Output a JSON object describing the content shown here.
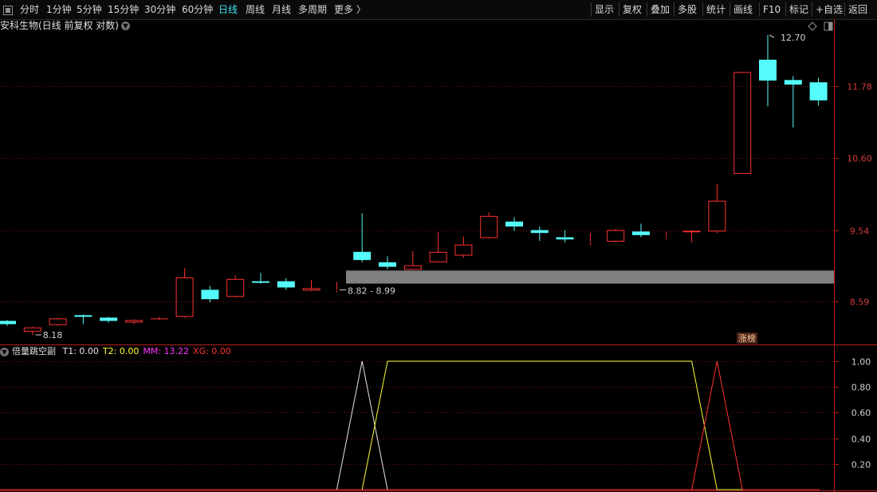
{
  "toolbar": {
    "left_items": [
      {
        "label": "分时"
      },
      {
        "label": "1分钟"
      },
      {
        "label": "5分钟"
      },
      {
        "label": "15分钟"
      },
      {
        "label": "30分钟"
      },
      {
        "label": "60分钟"
      },
      {
        "label": "日线",
        "active": true
      },
      {
        "label": "周线"
      },
      {
        "label": "月线"
      },
      {
        "label": "多周期"
      },
      {
        "label": "更多 〉"
      }
    ],
    "right_items": [
      {
        "label": "显示"
      },
      {
        "label": "复权"
      },
      {
        "label": "叠加"
      },
      {
        "label": "多股"
      },
      {
        "label": "统计"
      },
      {
        "label": "画线"
      },
      {
        "label": "F10"
      },
      {
        "label": "标记"
      },
      {
        "label": "+自选"
      },
      {
        "label": "返回"
      }
    ]
  },
  "main_chart": {
    "title": "安科生物(日线 前复权 对数)",
    "annotations": {
      "high_label": "12.70",
      "low_label": "8.18",
      "range_label": "8.82 - 8.99",
      "badge": "涨榜"
    }
  },
  "indicator": {
    "name": "倍量跳空副",
    "values": [
      {
        "key": "T1",
        "value": "0.00",
        "color": "#e6e6e6"
      },
      {
        "key": "T2",
        "value": "0.00",
        "color": "#ffff33"
      },
      {
        "key": "MM",
        "value": "13.22",
        "color": "#ff33ff"
      },
      {
        "key": "XG",
        "value": "0.00",
        "color": "#ff3333"
      }
    ]
  },
  "colors": {
    "up": "#ff3232",
    "down": "#54fcfc",
    "zone": "#808080",
    "axis": "#b41e1e",
    "grid": "#7a1010"
  },
  "chart_data": [
    {
      "type": "candlestick",
      "title": "",
      "y_scale": "log",
      "ylim": [
        8.18,
        12.7
      ],
      "y_ticks": [
        8.59,
        9.54,
        10.6,
        11.78
      ],
      "y_tick_labels": [
        "8.59",
        "9.54",
        "10.60",
        "11.78"
      ],
      "zone": {
        "low": 8.82,
        "high": 8.99
      },
      "candles": [
        {
          "o": 8.35,
          "c": 8.31,
          "h": 8.36,
          "l": 8.29
        },
        {
          "o": 8.22,
          "c": 8.27,
          "h": 8.28,
          "l": 8.18
        },
        {
          "o": 8.3,
          "c": 8.38,
          "h": 8.39,
          "l": 8.29
        },
        {
          "o": 8.42,
          "c": 8.4,
          "h": 8.43,
          "l": 8.31
        },
        {
          "o": 8.39,
          "c": 8.35,
          "h": 8.4,
          "l": 8.33
        },
        {
          "o": 8.33,
          "c": 8.36,
          "h": 8.37,
          "l": 8.31
        },
        {
          "o": 8.37,
          "c": 8.38,
          "h": 8.4,
          "l": 8.36
        },
        {
          "o": 8.4,
          "c": 8.9,
          "h": 9.02,
          "l": 8.39
        },
        {
          "o": 8.74,
          "c": 8.62,
          "h": 8.79,
          "l": 8.58
        },
        {
          "o": 8.65,
          "c": 8.88,
          "h": 8.93,
          "l": 8.64
        },
        {
          "o": 8.85,
          "c": 8.83,
          "h": 8.96,
          "l": 8.82
        },
        {
          "o": 8.85,
          "c": 8.77,
          "h": 8.89,
          "l": 8.74
        },
        {
          "o": 8.73,
          "c": 8.76,
          "h": 8.87,
          "l": 8.72
        },
        {
          "o": 8.73,
          "c": 8.74,
          "h": 8.84,
          "l": 8.71
        },
        {
          "o": 9.24,
          "c": 9.13,
          "h": 9.78,
          "l": 9.1
        },
        {
          "o": 9.1,
          "c": 9.04,
          "h": 9.18,
          "l": 9.01
        },
        {
          "o": 9.0,
          "c": 9.06,
          "h": 9.25,
          "l": 9.0
        },
        {
          "o": 9.1,
          "c": 9.24,
          "h": 9.51,
          "l": 9.1
        },
        {
          "o": 9.19,
          "c": 9.34,
          "h": 9.45,
          "l": 9.16
        },
        {
          "o": 9.43,
          "c": 9.74,
          "h": 9.79,
          "l": 9.42
        },
        {
          "o": 9.66,
          "c": 9.59,
          "h": 9.72,
          "l": 9.53
        },
        {
          "o": 9.54,
          "c": 9.5,
          "h": 9.59,
          "l": 9.39
        },
        {
          "o": 9.44,
          "c": 9.41,
          "h": 9.54,
          "l": 9.37
        },
        {
          "o": 9.37,
          "c": 9.38,
          "h": 9.5,
          "l": 9.33
        },
        {
          "o": 9.38,
          "c": 9.54,
          "h": 9.56,
          "l": 9.37
        },
        {
          "o": 9.52,
          "c": 9.47,
          "h": 9.63,
          "l": 9.44
        },
        {
          "o": 9.44,
          "c": 9.45,
          "h": 9.52,
          "l": 9.41
        },
        {
          "o": 9.51,
          "c": 9.53,
          "h": 9.54,
          "l": 9.37
        },
        {
          "o": 9.52,
          "c": 9.96,
          "h": 10.21,
          "l": 9.5
        },
        {
          "o": 10.36,
          "c": 12.03,
          "h": 12.03,
          "l": 10.36
        },
        {
          "o": 12.25,
          "c": 11.88,
          "h": 12.7,
          "l": 11.44
        },
        {
          "o": 11.89,
          "c": 11.81,
          "h": 11.96,
          "l": 11.09
        },
        {
          "o": 11.85,
          "c": 11.54,
          "h": 11.93,
          "l": 11.45
        }
      ]
    },
    {
      "type": "line",
      "title": "",
      "ylim": [
        0,
        1.1
      ],
      "y_ticks": [
        0.2,
        0.4,
        0.6,
        0.8,
        1.0
      ],
      "y_tick_labels": [
        "0.20",
        "0.40",
        "0.60",
        "0.80",
        "1.00"
      ],
      "series": [
        {
          "name": "T1",
          "color": "#e6e6e6",
          "points": [
            [
              13,
              0
            ],
            [
              14,
              1
            ],
            [
              15,
              0
            ]
          ]
        },
        {
          "name": "T2",
          "color": "#ffff33",
          "points": [
            [
              14,
              0
            ],
            [
              15,
              1
            ],
            [
              27,
              1
            ],
            [
              28,
              0
            ],
            [
              29,
              0
            ]
          ]
        },
        {
          "name": "XG",
          "color": "#ff3333",
          "points": [
            [
              27,
              0
            ],
            [
              28,
              1
            ],
            [
              29,
              0
            ]
          ]
        }
      ]
    }
  ]
}
